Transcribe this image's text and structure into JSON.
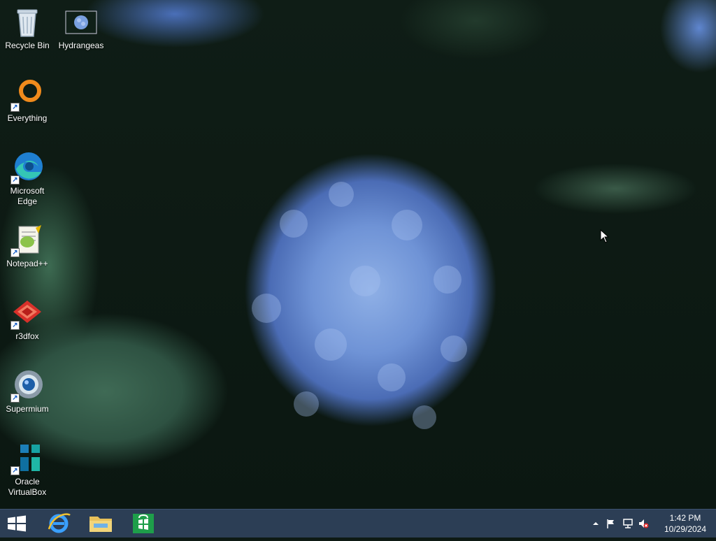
{
  "desktop": {
    "icons": [
      {
        "label": "Recycle Bin",
        "icon": "recycle-bin-icon"
      },
      {
        "label": "Hydrangeas",
        "icon": "image-file-icon"
      },
      {
        "label": "Everything",
        "icon": "everything-search-icon"
      },
      {
        "label": "Microsoft Edge",
        "icon": "edge-browser-icon"
      },
      {
        "label": "Notepad++",
        "icon": "notepad-plus-plus-icon"
      },
      {
        "label": "r3dfox",
        "icon": "r3dfox-browser-icon"
      },
      {
        "label": "Supermium",
        "icon": "supermium-browser-icon"
      },
      {
        "label": "Oracle VirtualBox",
        "icon": "virtualbox-icon"
      }
    ]
  },
  "taskbar": {
    "pinned": [
      {
        "name": "Internet Explorer",
        "icon": "internet-explorer-icon"
      },
      {
        "name": "File Explorer",
        "icon": "file-explorer-icon"
      },
      {
        "name": "Store",
        "icon": "store-icon"
      }
    ],
    "tray": {
      "icons": [
        "show-hidden-icons-chevron",
        "action-center-flag-icon",
        "network-icon",
        "volume-muted-icon"
      ],
      "time": "1:42 PM",
      "date": "10/29/2024"
    }
  },
  "colors": {
    "taskbar_bg": "#2c3e55",
    "edge_teal": "#1fb6a6",
    "ie_blue": "#1e90ff",
    "store_green": "#1e9e4a",
    "everything_orange": "#f08a1c",
    "r3dfox_red": "#d8302a"
  }
}
